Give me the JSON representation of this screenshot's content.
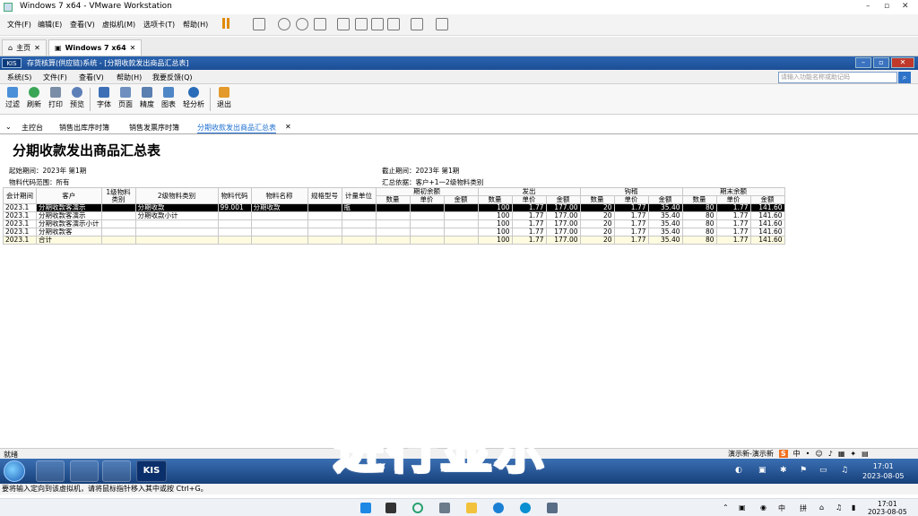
{
  "vmware": {
    "title": "Windows 7 x64 - VMware Workstation",
    "menu": [
      "文件(F)",
      "编辑(E)",
      "查看(V)",
      "虚拟机(M)",
      "选项卡(T)",
      "帮助(H)"
    ],
    "tabs": [
      {
        "label": "主页"
      },
      {
        "label": "Windows 7 x64"
      }
    ],
    "status_text": "要将输入定向到该虚拟机，请将鼠标指针移入其中或按 Ctrl+G。"
  },
  "kis": {
    "logo": "KIS",
    "title": "存货核算(供应链)系统 - [分期收款发出商品汇总表]",
    "menu": [
      "系统(S)",
      "文件(F)",
      "查看(V)",
      "帮助(H)",
      "我要反馈(Q)"
    ],
    "search_placeholder": "请输入功能名称或助记码",
    "toolbar": [
      {
        "label": "过滤",
        "icon": "filter-icon"
      },
      {
        "label": "刷新",
        "icon": "refresh-icon"
      },
      {
        "label": "打印",
        "icon": "print-icon"
      },
      {
        "label": "预览",
        "icon": "preview-icon"
      },
      {
        "label": "字体",
        "icon": "font-icon"
      },
      {
        "label": "页面",
        "icon": "page-icon"
      },
      {
        "label": "精度",
        "icon": "precision-icon"
      },
      {
        "label": "图表",
        "icon": "chart-icon"
      },
      {
        "label": "轻分析",
        "icon": "analysis-icon"
      },
      {
        "label": "退出",
        "icon": "exit-icon"
      }
    ],
    "nav": [
      "主控台",
      "销售出库序时簿",
      "销售发票序时簿",
      "分期收款发出商品汇总表"
    ],
    "status": "就绪"
  },
  "report": {
    "title": "分期收款发出商品汇总表",
    "start_period": "起始期间：2023年 第1期",
    "end_period": "截止期间：2023年 第1期",
    "material_range": "物料代码范围：所有",
    "summary_basis": "汇总依据：客户+1一2级物料类别",
    "headers_top": {
      "period": "会计期间",
      "customer": "客户",
      "cat1": "1级物料类别",
      "cat2": "2级物料类别",
      "code": "物料代码",
      "name": "物料名称",
      "spec": "规格型号",
      "unit": "计量单位",
      "opening": "期初余额",
      "shipped": "发出",
      "settled": "钩稽",
      "closing": "期末余额"
    },
    "sub": {
      "qty": "数量",
      "price": "单价",
      "amount": "金额"
    },
    "rows": [
      [
        "2023.1",
        "分期收款客演示",
        "",
        "分期收款",
        "99.001",
        "分期收款",
        "",
        "瓶",
        "",
        "",
        "",
        "100",
        "1.77",
        "177.00",
        "20",
        "1.77",
        "35.40",
        "80",
        "1.77",
        "141.60"
      ],
      [
        "2023.1",
        "分期收款客演示",
        "",
        "分期收款小计",
        "",
        "",
        "",
        "",
        "",
        "",
        "",
        "100",
        "1.77",
        "177.00",
        "20",
        "1.77",
        "35.40",
        "80",
        "1.77",
        "141.60"
      ],
      [
        "2023.1",
        "分期收款客演示小计",
        "",
        "",
        "",
        "",
        "",
        "",
        "",
        "",
        "",
        "100",
        "1.77",
        "177.00",
        "20",
        "1.77",
        "35.40",
        "80",
        "1.77",
        "141.60"
      ],
      [
        "2023.1",
        "分期收款客",
        "",
        "",
        "",
        "",
        "",
        "",
        "",
        "",
        "",
        "100",
        "1.77",
        "177.00",
        "20",
        "1.77",
        "35.40",
        "80",
        "1.77",
        "141.60"
      ],
      [
        "2023.1",
        "合计",
        "",
        "",
        "",
        "",
        "",
        "",
        "",
        "",
        "",
        "100",
        "1.77",
        "177.00",
        "20",
        "1.77",
        "35.40",
        "80",
        "1.77",
        "141.60"
      ]
    ]
  },
  "ime": {
    "label": "演示新-演示新",
    "lang": "中"
  },
  "win7": {
    "time": "17:01",
    "date": "2023-08-05"
  },
  "win11": {
    "lang": "中",
    "ime": "拼",
    "time": "17:01",
    "date": "2023-08-05"
  },
  "caption": "进行显示",
  "colors": {
    "kis_title": "#1b4f96",
    "selected_row": "#000000",
    "caption": "#f0a0e8"
  }
}
